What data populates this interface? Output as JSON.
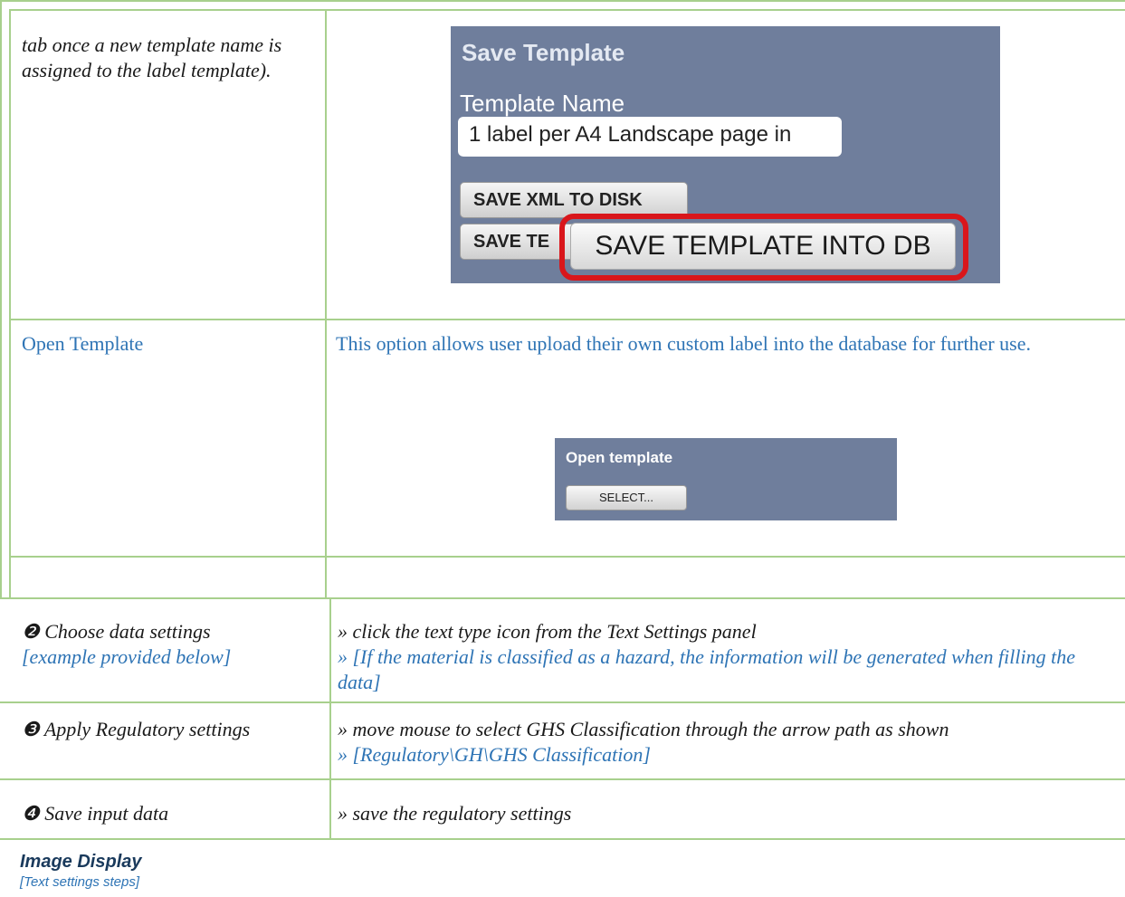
{
  "table_top": {
    "row1": {
      "left_text": "tab once a new template name is assigned to the label template).",
      "screenshot": {
        "title": "Save Template",
        "field_label": "Template Name",
        "field_value": "1 label per A4 Landscape page in",
        "button_xml": "SAVE XML TO DISK",
        "button_partial": "SAVE TE",
        "button_db": "SAVE TEMPLATE INTO DB"
      }
    },
    "row2": {
      "left_text": "Open Template",
      "right_text": "This option allows user upload their own custom label into the database for further use.",
      "screenshot": {
        "title": "Open template",
        "button": "SELECT..."
      }
    }
  },
  "steps": [
    {
      "icon": "❷",
      "title": "Choose data settings",
      "subtitle": "[example provided below]",
      "line1": "» click the text type icon from the Text Settings panel",
      "line2": "» [If the material is classified as a hazard, the information will be generated when filling the data]"
    },
    {
      "icon": "❸",
      "title": "Apply Regulatory settings",
      "line1": "» move mouse to select GHS Classification through the arrow path as shown",
      "line2": "» [Regulatory\\GH\\GHS Classification]"
    },
    {
      "icon": "❹",
      "title": "Save input data",
      "line1": "» save the regulatory settings"
    }
  ],
  "footer": {
    "title": "Image Display",
    "subtitle": "[Text settings steps]"
  }
}
